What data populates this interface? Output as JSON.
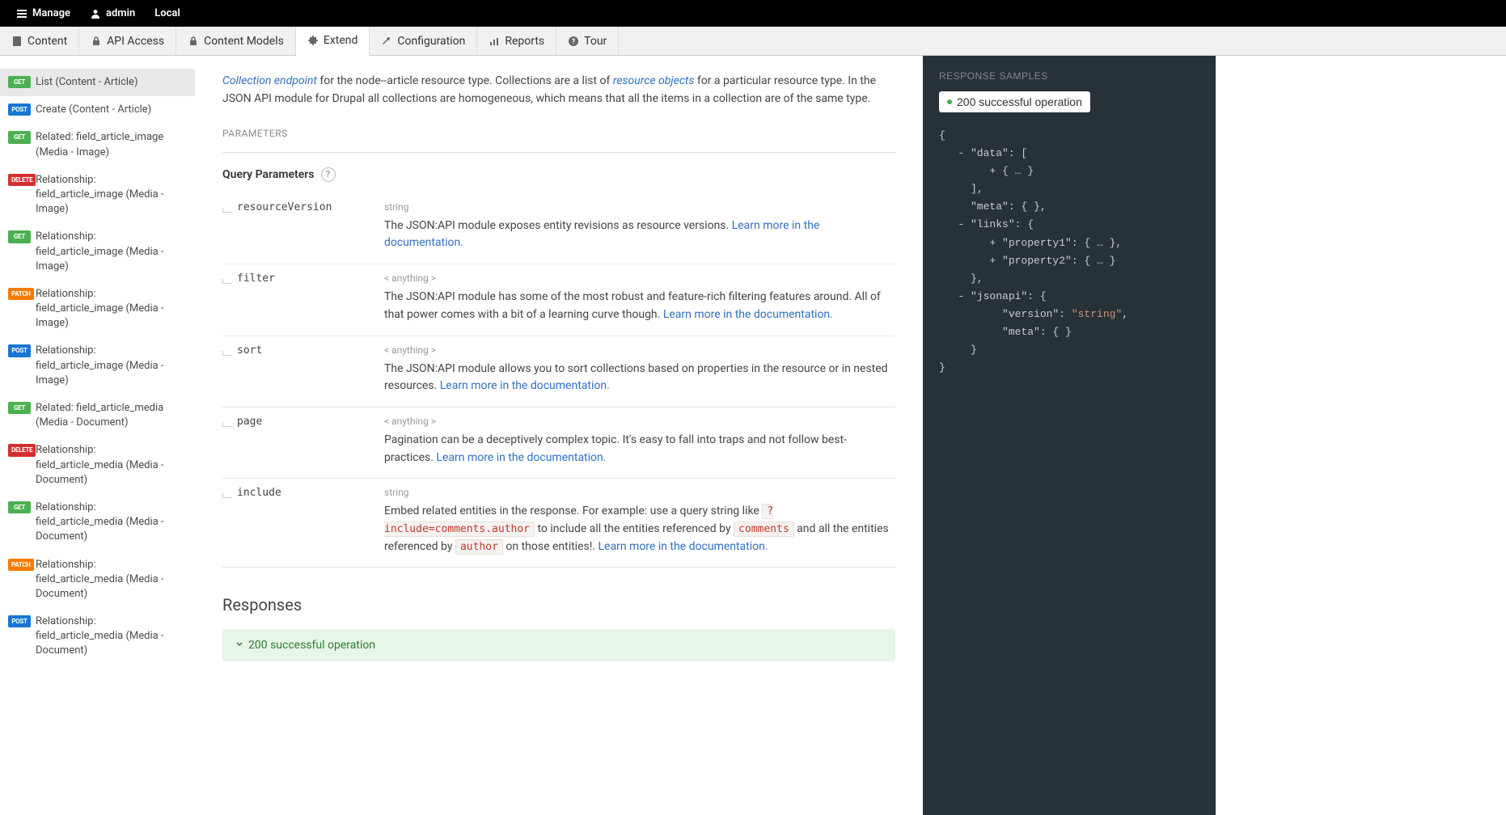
{
  "topbar": {
    "manage": "Manage",
    "user": "admin",
    "env": "Local"
  },
  "nav": {
    "content": "Content",
    "api_access": "API Access",
    "content_models": "Content Models",
    "extend": "Extend",
    "configuration": "Configuration",
    "reports": "Reports",
    "tour": "Tour"
  },
  "sidebar": {
    "items": [
      {
        "method": "GET",
        "label": "List (Content - Article)",
        "selected": true
      },
      {
        "method": "POST",
        "label": "Create (Content - Article)"
      },
      {
        "method": "GET",
        "label": "Related: field_article_image (Media - Image)"
      },
      {
        "method": "DELETE",
        "label": "Relationship: field_article_image (Media - Image)"
      },
      {
        "method": "GET",
        "label": "Relationship: field_article_image (Media - Image)"
      },
      {
        "method": "PATCH",
        "label": "Relationship: field_article_image (Media - Image)"
      },
      {
        "method": "POST",
        "label": "Relationship: field_article_image (Media - Image)"
      },
      {
        "method": "GET",
        "label": "Related: field_article_media (Media - Document)"
      },
      {
        "method": "DELETE",
        "label": "Relationship: field_article_media (Media - Document)"
      },
      {
        "method": "GET",
        "label": "Relationship: field_article_media (Media - Document)"
      },
      {
        "method": "PATCH",
        "label": "Relationship: field_article_media (Media - Document)"
      },
      {
        "method": "POST",
        "label": "Relationship: field_article_media (Media - Document)"
      }
    ]
  },
  "intro": {
    "link1": "Collection endpoint",
    "text1": " for the node--article resource type. Collections are a list of ",
    "link2": "resource objects",
    "text2": " for a particular resource type. In the JSON API module for Drupal all collections are homogeneous, which means that all the items in a collection are of the same type."
  },
  "parameters": {
    "label": "PARAMETERS",
    "query_label": "Query Parameters",
    "help": "?",
    "rows": [
      {
        "name": "resourceVersion",
        "type": "string",
        "desc": "The JSON:API module exposes entity revisions as resource versions. ",
        "link": "Learn more in the documentation."
      },
      {
        "name": "filter",
        "type": "< anything >",
        "desc": "The JSON:API module has some of the most robust and feature-rich filtering features around. All of that power comes with a bit of a learning curve though. ",
        "link": "Learn more in the documentation."
      },
      {
        "name": "sort",
        "type": "< anything >",
        "desc": "The JSON:API module allows you to sort collections based on properties in the resource or in nested resources. ",
        "link": "Learn more in the documentation."
      },
      {
        "name": "page",
        "type": "< anything >",
        "desc": "Pagination can be a deceptively complex topic. It's easy to fall into traps and not follow best-practices. ",
        "link": "Learn more in the documentation."
      },
      {
        "name": "include",
        "type": "string",
        "desc_pre": "Embed related entities in the response. For example: use a query string like ",
        "code1": "?include=comments.author",
        "desc_mid1": " to include all the entities referenced by ",
        "code2": "comments",
        "desc_mid2": " and all the entities referenced by ",
        "code3": "author",
        "desc_post": " on those entities!. ",
        "link": "Learn more in the documentation."
      }
    ]
  },
  "responses": {
    "heading": "Responses",
    "item": "200 successful operation"
  },
  "rightpanel": {
    "heading": "RESPONSE SAMPLES",
    "badge": "200 successful operation",
    "json": {
      "l1": "{",
      "l2": "   - \"data\": [",
      "l3": "        + { … }",
      "l4": "     ],",
      "l5": "     \"meta\": { },",
      "l6": "   - \"links\": {",
      "l7": "        + \"property1\": { … },",
      "l8": "        + \"property2\": { … }",
      "l9": "     },",
      "l10": "   - \"jsonapi\": {",
      "l11k": "          \"version\": ",
      "l11v": "\"string\"",
      "l11e": ",",
      "l12": "          \"meta\": { }",
      "l13": "     }",
      "l14": "}"
    }
  }
}
